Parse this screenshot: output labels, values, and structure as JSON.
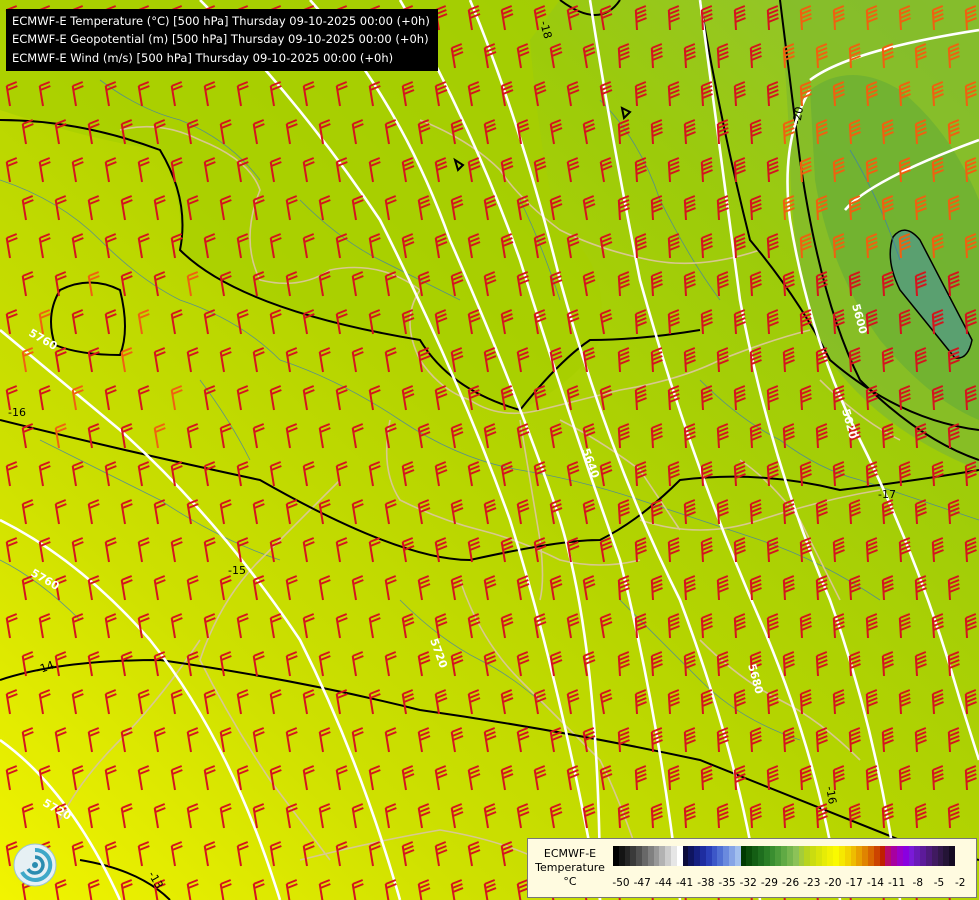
{
  "header": {
    "lines": [
      "ECMWF-E Temperature (°C) [500 hPa] Thursday 09-10-2025 00:00 (+0h)",
      "ECMWF-E Geopotential (m) [500 hPa] Thursday 09-10-2025 00:00 (+0h)",
      "ECMWF-E Wind (m/s) [500 hPa] Thursday 09-10-2025 00:00 (+0h)"
    ]
  },
  "geopotential_labels": [
    "5760",
    "5720",
    "5680",
    "5640",
    "5620",
    "5600",
    "5760",
    "5720"
  ],
  "temperature_labels": [
    "-18",
    "-20",
    "-18",
    "-16",
    "-15",
    "-14",
    "-13",
    "-16",
    "-17",
    "-16"
  ],
  "legend": {
    "title_line1": "ECMWF-E",
    "title_line2": "Temperature",
    "unit": "°C",
    "ticks": [
      "-50",
      "-47",
      "-44",
      "-41",
      "-38",
      "-35",
      "-32",
      "-29",
      "-26",
      "-23",
      "-20",
      "-17",
      "-14",
      "-11",
      "-8",
      "-5",
      "-2"
    ],
    "colors": [
      "#000000",
      "#141414",
      "#262626",
      "#3a3a3a",
      "#505050",
      "#686868",
      "#808080",
      "#989898",
      "#b2b2b2",
      "#cccccc",
      "#e6e6e6",
      "#ffffff",
      "#0b0b3a",
      "#0f1560",
      "#162080",
      "#1e2da0",
      "#2a3fb8",
      "#3c57c8",
      "#5070d4",
      "#6a8ade",
      "#86a4e6",
      "#a2bfee",
      "#003a00",
      "#0a4d0a",
      "#145e14",
      "#1e6e1e",
      "#2a7e26",
      "#3a8e30",
      "#4c9c3a",
      "#60aa44",
      "#76b64e",
      "#8cc258",
      "#a4cc3a",
      "#b8d41e",
      "#cadc10",
      "#d8e40a",
      "#e6ec06",
      "#f2f204",
      "#fafa00",
      "#f6e800",
      "#f2d400",
      "#eebc00",
      "#e8a000",
      "#e08400",
      "#d86600",
      "#cc4400",
      "#c02000",
      "#b80c6a",
      "#a800a0",
      "#9a00c8",
      "#8a00e0",
      "#7a1ad8",
      "#6a1ab8",
      "#5c1a9a",
      "#4e1a7c",
      "#401a60",
      "#32184a",
      "#241436",
      "#140a22"
    ]
  },
  "colors": {
    "barb": "#d4141e",
    "barb_strong": "#f06010",
    "geopotential_contour": "#ffffff",
    "temperature_contour": "#000000",
    "border": "#d8c890",
    "river": "#3a7ab8"
  }
}
